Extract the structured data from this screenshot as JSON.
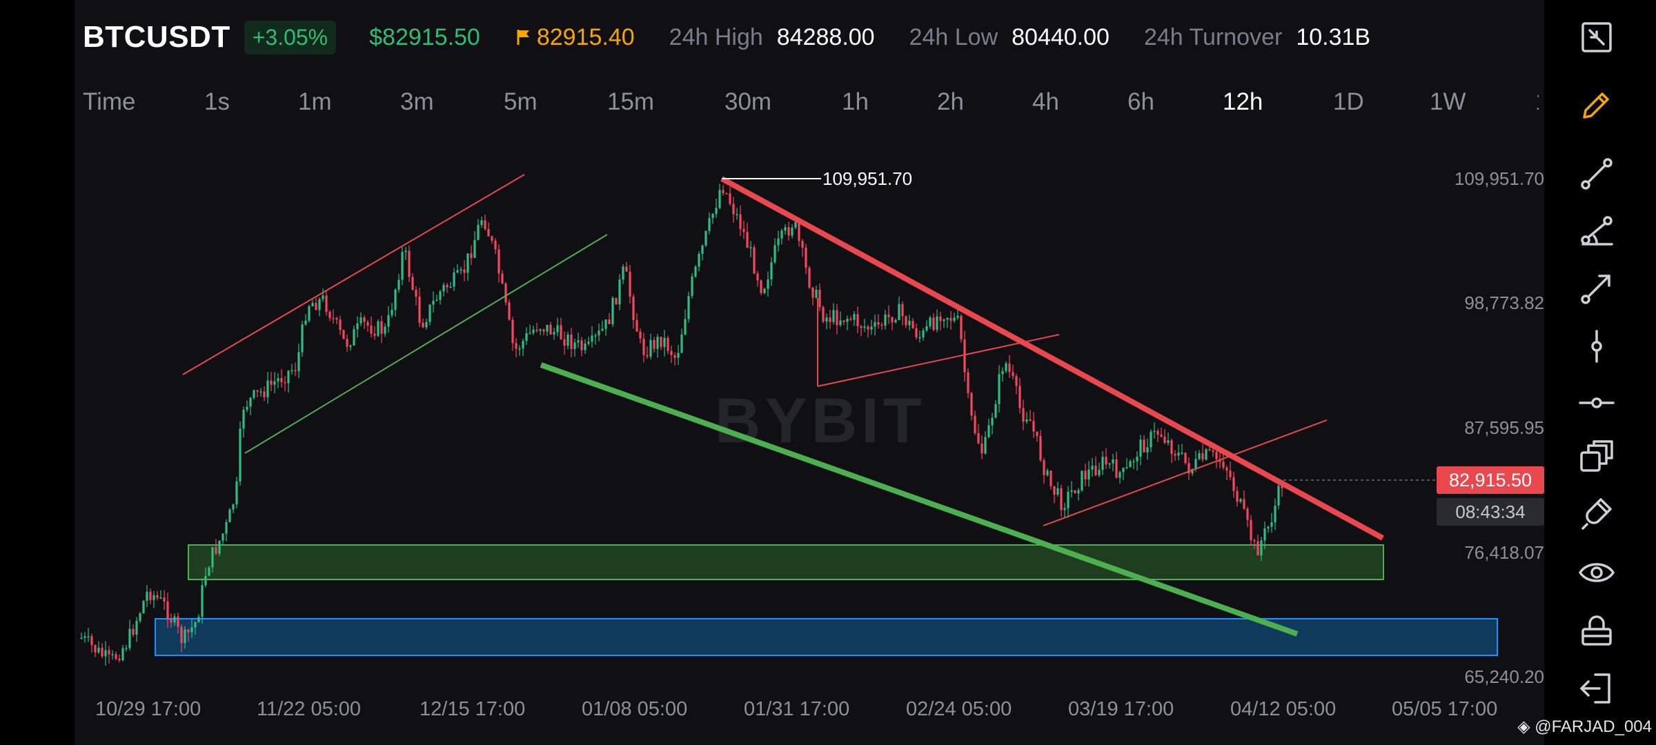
{
  "header": {
    "symbol": "BTCUSDT",
    "change": "+3.05%",
    "last_price": "$82915.50",
    "mark_price": "82915.40",
    "high_label": "24h High",
    "high_value": "84288.00",
    "low_label": "24h Low",
    "low_value": "80440.00",
    "turnover_label": "24h Turnover",
    "turnover_value": "10.31B"
  },
  "timeframes": {
    "items": [
      "Time",
      "1s",
      "1m",
      "3m",
      "5m",
      "15m",
      "30m",
      "1h",
      "2h",
      "4h",
      "6h",
      "12h",
      "1D",
      "1W",
      "1"
    ],
    "active": "12h"
  },
  "price_axis": {
    "labels": [
      "109,951.70",
      "98,773.82",
      "87,595.95",
      "76,418.07",
      "65,240.20"
    ]
  },
  "time_axis": {
    "labels": [
      "10/29 17:00",
      "11/22 05:00",
      "12/15 17:00",
      "01/08 05:00",
      "01/31 17:00",
      "02/24 05:00",
      "03/19 17:00",
      "04/12 05:00",
      "05/05 17:00"
    ]
  },
  "chart": {
    "peak_label": "109,951.70",
    "current_price_tag": "82,915.50",
    "countdown": "08:43:34",
    "watermark": "BYBIT",
    "candle_up_color": "#2ebd85",
    "candle_down_color": "#f6465d",
    "support_zone_color": "#1f3d1f",
    "demand_zone_color": "#0f3a5c"
  },
  "toolbar": {
    "icons": [
      "fullscreen-exit-icon",
      "pencil-icon",
      "trendline-icon",
      "angle-icon",
      "ray-icon",
      "vertical-line-icon",
      "horizontal-line-icon",
      "layers-icon",
      "magnet-icon",
      "eye-icon",
      "lock-icon",
      "exit-icon"
    ]
  },
  "credit": "@FARJAD_004"
}
